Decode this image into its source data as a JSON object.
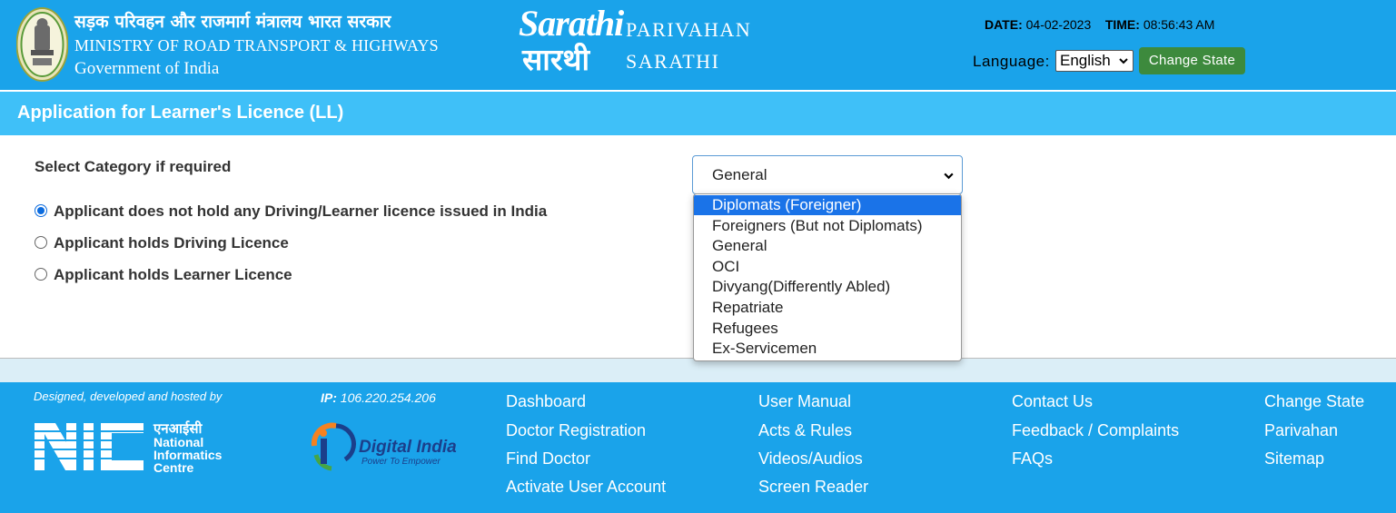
{
  "header": {
    "ministry_hindi": "सड़क परिवहन और राजमार्ग मंत्रालय भारत सरकार",
    "ministry_english": "MINISTRY OF ROAD TRANSPORT & HIGHWAYS",
    "government": "Government of India",
    "logo_script": "Sarathi",
    "logo_hindi": "सारथी",
    "brand_line1": "PARIVAHAN",
    "brand_line2": "SARATHI",
    "date_label": "DATE:",
    "date_value": "04-02-2023",
    "time_label": "TIME:",
    "time_value": "08:56:43 AM",
    "language_label": "Language:",
    "language_value": "English",
    "change_state_label": "Change State"
  },
  "page": {
    "title": "Application for Learner's Licence (LL)"
  },
  "form": {
    "category_label": "Select Category if required",
    "category_value": "General",
    "radios": [
      {
        "label": "Applicant does not hold any Driving/Learner licence issued in India",
        "checked": true
      },
      {
        "label": "Applicant holds Driving Licence",
        "checked": false
      },
      {
        "label": "Applicant holds Learner Licence",
        "checked": false
      }
    ],
    "dropdown_options": [
      "Diplomats (Foreigner)",
      "Foreigners (But not Diplomats)",
      "General",
      "OCI",
      "Divyang(Differently Abled)",
      "Repatriate",
      "Refugees",
      "Ex-Servicemen"
    ],
    "highlighted_option": "Diplomats (Foreigner)"
  },
  "footer": {
    "designed_text": "Designed, developed and hosted by",
    "ip_label": "IP:",
    "ip_value": "106.220.254.206",
    "nic_hindi": "एनआईसी",
    "nic_name_1": "National",
    "nic_name_2": "Informatics",
    "nic_name_3": "Centre",
    "di_title": "Digital India",
    "di_tagline": "Power To Empower",
    "col1": [
      "Dashboard",
      "Doctor Registration",
      "Find Doctor",
      "Activate User Account"
    ],
    "col2": [
      "User Manual",
      "Acts & Rules",
      "Videos/Audios",
      "Screen Reader"
    ],
    "col3": [
      "Contact Us",
      "Feedback / Complaints",
      "FAQs"
    ],
    "col4": [
      "Change State",
      "Parivahan",
      "Sitemap"
    ]
  },
  "colors": {
    "header_blue": "#1aa3ea",
    "title_band": "#3fc0f8",
    "change_state_green": "#3d8a3d",
    "option_highlight": "#1a73e8"
  }
}
